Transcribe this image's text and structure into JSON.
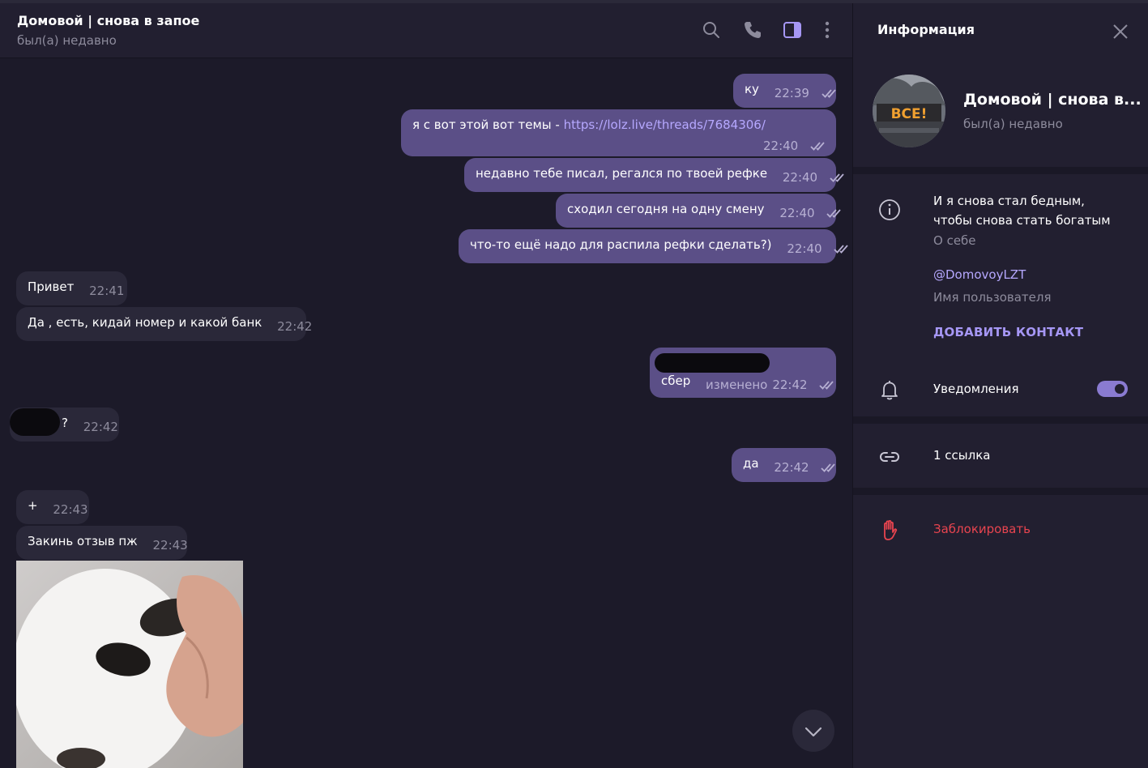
{
  "chat": {
    "title": "Домовой | снова в запое",
    "status": "был(а) недавно",
    "icons": [
      "search-icon",
      "phone-icon",
      "sidebar-toggle-icon",
      "more-vertical-icon"
    ]
  },
  "messages": {
    "m1": {
      "text": "ку",
      "time": "22:39"
    },
    "m2": {
      "text": "я с вот этой вот темы - ",
      "link": "https://lolz.live/threads/7684306/",
      "time": "22:40"
    },
    "m3": {
      "text": "недавно тебе писал, регался по твоей рефке",
      "time": "22:40"
    },
    "m4": {
      "text": "сходил сегодня на одну смену",
      "time": "22:40"
    },
    "m5": {
      "text": "что-то ещё надо для распила рефки сделать?)",
      "time": "22:40"
    },
    "m6": {
      "text": "Привет",
      "time": "22:41"
    },
    "m7": {
      "text": "Да , есть, кидай номер и какой банк",
      "time": "22:42"
    },
    "m8": {
      "text": "сбер",
      "edited": "изменено",
      "time": "22:42"
    },
    "m9": {
      "text": "?",
      "time": "22:42"
    },
    "m10": {
      "text": "да",
      "time": "22:42"
    },
    "m11": {
      "text": "+",
      "time": "22:43"
    },
    "m12": {
      "text": "Закинь отзыв пж",
      "time": "22:43"
    }
  },
  "info": {
    "title": "Информация",
    "name": "Домовой | снова в...",
    "status": "был(а) недавно",
    "avatar_text": "ВСЕ!",
    "bio_line1": "И я снова стал бедным,",
    "bio_line2": "чтобы снова стать богатым",
    "bio_label": "О себе",
    "username": "@DomovoyLZT",
    "username_label": "Имя пользователя",
    "add_contact": "ДОБАВИТЬ КОНТАКТ",
    "notifications": "Уведомления",
    "notifications_on": true,
    "links": "1 ссылка",
    "block": "Заблокировать"
  },
  "colors": {
    "background": "#1c1a29",
    "panel": "#221f30",
    "outgoing_bubble": "#5b4f87",
    "incoming_bubble": "#2a2839",
    "accent": "#b6a8ff",
    "danger": "#e8444f"
  }
}
